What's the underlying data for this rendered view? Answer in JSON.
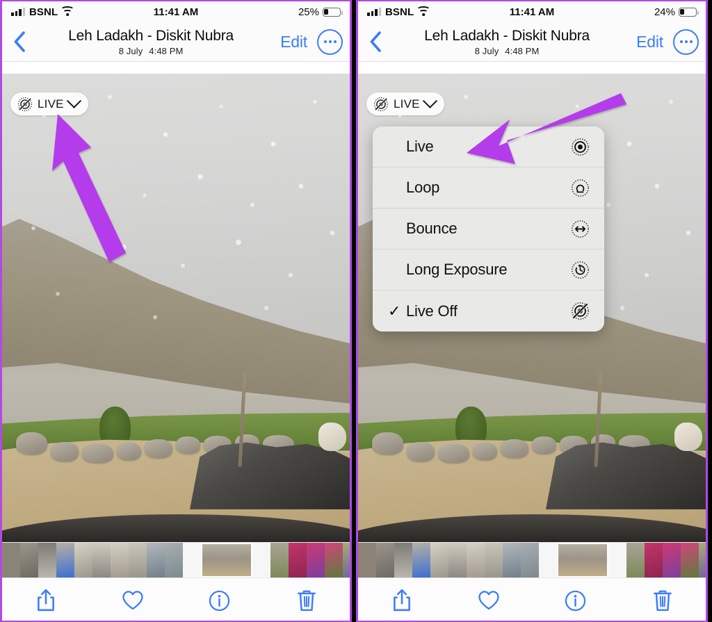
{
  "panels": [
    {
      "id": "left",
      "status": {
        "carrier": "BSNL",
        "time": "11:41 AM",
        "battery_pct": "25%",
        "battery_level": 25
      },
      "nav": {
        "back_icon": "chevron-left-icon",
        "title": "Leh Ladakh - Diskit Nubra",
        "subtitle_date": "8 July",
        "subtitle_time": "4:48 PM",
        "edit_label": "Edit",
        "more_icon": "ellipsis-circle-icon"
      },
      "live_badge": {
        "icon": "live-photo-off-icon",
        "label": "LIVE",
        "chevron": "chevron-down-icon"
      },
      "menu_open": false,
      "annotation": {
        "type": "arrow",
        "color": "#b43cea",
        "points_to": "live-badge"
      }
    },
    {
      "id": "right",
      "status": {
        "carrier": "BSNL",
        "time": "11:41 AM",
        "battery_pct": "24%",
        "battery_level": 24
      },
      "nav": {
        "back_icon": "chevron-left-icon",
        "title": "Leh Ladakh - Diskit Nubra",
        "subtitle_date": "8 July",
        "subtitle_time": "4:48 PM",
        "edit_label": "Edit",
        "more_icon": "ellipsis-circle-icon"
      },
      "live_badge": {
        "icon": "live-photo-off-icon",
        "label": "LIVE",
        "chevron": "chevron-down-icon"
      },
      "menu_open": true,
      "annotation": {
        "type": "arrow",
        "color": "#b43cea",
        "points_to": "menu-item-live"
      }
    }
  ],
  "live_menu": {
    "items": [
      {
        "label": "Live",
        "icon": "live-photo-icon",
        "checked": false,
        "check_glyph": ""
      },
      {
        "label": "Loop",
        "icon": "loop-icon",
        "checked": false,
        "check_glyph": ""
      },
      {
        "label": "Bounce",
        "icon": "bounce-icon",
        "checked": false,
        "check_glyph": ""
      },
      {
        "label": "Long Exposure",
        "icon": "long-exposure-icon",
        "checked": false,
        "check_glyph": ""
      },
      {
        "label": "Live Off",
        "icon": "live-photo-off-icon",
        "checked": true,
        "check_glyph": "✓"
      }
    ]
  },
  "toolbar": {
    "items": [
      {
        "name": "share-button",
        "icon": "share-icon",
        "label": "Share"
      },
      {
        "name": "favorite-button",
        "icon": "heart-icon",
        "label": "Favorite"
      },
      {
        "name": "info-button",
        "icon": "info-icon",
        "label": "Info"
      },
      {
        "name": "delete-button",
        "icon": "trash-icon",
        "label": "Delete"
      }
    ]
  },
  "colors": {
    "accent_blue": "#3b7dfb",
    "annotation_purple": "#b43cea",
    "panel_border": "#b14ae0",
    "menu_bg": "#e9e9e7"
  },
  "filmstrip": {
    "thumbs": [
      "#8b8377",
      "#6e6a62",
      "#b7b3ab",
      "#5c5b57",
      "#cfc9bd",
      "#b9b5ac",
      "#c6c1b6",
      "#b2aea5",
      "#9aa0a4",
      "#8e9398",
      "#b9b2a4",
      "#a79f92",
      "#c23a6e",
      "#cc3a72",
      "#d1467c",
      "#9aa06a",
      "#837f77",
      "#7d7971",
      "#5f5c58",
      "#6b6661",
      "#8d8781"
    ],
    "selected_index": 11
  }
}
